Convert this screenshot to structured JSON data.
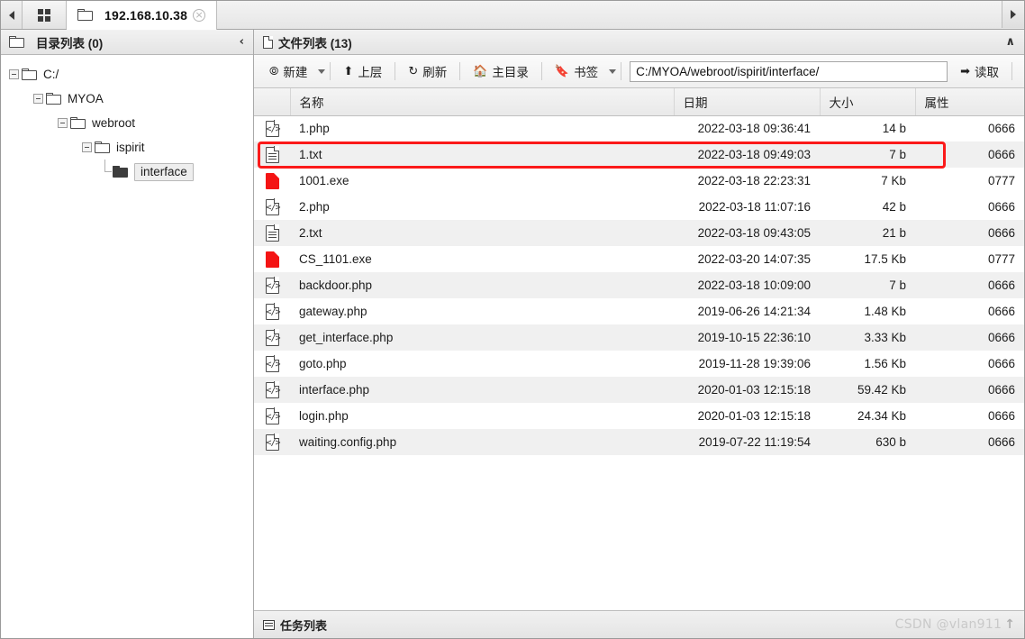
{
  "window": {
    "tab_scroll_left_icon": "triangle-left-icon",
    "tab_scroll_right_icon": "triangle-right-icon",
    "home_tab_icon": "grid-apps-icon",
    "collapse_icon": "chevron-up-icon"
  },
  "tabs": [
    {
      "label": "192.168.10.38",
      "icon": "folder-icon",
      "active": true,
      "closable": true,
      "close_label": "×"
    }
  ],
  "tree_panel": {
    "title": "目录列表 (0)",
    "title_icon": "folder-icon",
    "collapse_icon": "chevron-left-icon",
    "collapse_label": "‹",
    "nodes": [
      {
        "label": "C:/",
        "depth": 0,
        "expanded": true,
        "selected": false,
        "icon": "folder-open-icon"
      },
      {
        "label": "MYOA",
        "depth": 1,
        "expanded": true,
        "selected": false,
        "icon": "folder-open-icon"
      },
      {
        "label": "webroot",
        "depth": 2,
        "expanded": true,
        "selected": false,
        "icon": "folder-open-icon"
      },
      {
        "label": "ispirit",
        "depth": 3,
        "expanded": true,
        "selected": false,
        "icon": "folder-open-icon"
      },
      {
        "label": "interface",
        "depth": 4,
        "expanded": false,
        "selected": true,
        "icon": "folder-filled-icon"
      }
    ]
  },
  "file_panel": {
    "title": "文件列表 (13)",
    "title_icon": "document-icon",
    "collapse_label": "∧",
    "toolbar": {
      "new_label": "新建",
      "new_icon": "plus-circle-icon",
      "new_has_dropdown": true,
      "up_label": "上层",
      "up_icon": "arrow-up-icon",
      "refresh_label": "刷新",
      "refresh_icon": "refresh-icon",
      "home_label": "主目录",
      "home_icon": "home-icon",
      "bookmark_label": "书签",
      "bookmark_icon": "bookmark-icon",
      "bookmark_has_dropdown": true,
      "path_value": "C:/MYOA/webroot/ispirit/interface/",
      "path_placeholder": "",
      "read_label": "读取",
      "read_icon": "arrow-right-icon"
    },
    "columns": [
      "",
      "名称",
      "日期",
      "大小",
      "属性"
    ],
    "rows": [
      {
        "icon": "php-file-icon",
        "name": "1.php",
        "date": "2022-03-18 09:36:41",
        "size": "14 b",
        "attr": "0666",
        "danger": false
      },
      {
        "icon": "txt-file-icon",
        "name": "1.txt",
        "date": "2022-03-18 09:49:03",
        "size": "7 b",
        "attr": "0666",
        "danger": false
      },
      {
        "icon": "exe-file-icon",
        "name": "1001.exe",
        "date": "2022-03-18 22:23:31",
        "size": "7 Kb",
        "attr": "0777",
        "danger": true
      },
      {
        "icon": "php-file-icon",
        "name": "2.php",
        "date": "2022-03-18 11:07:16",
        "size": "42 b",
        "attr": "0666",
        "danger": false
      },
      {
        "icon": "txt-file-icon",
        "name": "2.txt",
        "date": "2022-03-18 09:43:05",
        "size": "21 b",
        "attr": "0666",
        "danger": false
      },
      {
        "icon": "exe-file-icon",
        "name": "CS_1101.exe",
        "date": "2022-03-20 14:07:35",
        "size": "17.5 Kb",
        "attr": "0777",
        "danger": true
      },
      {
        "icon": "php-file-icon",
        "name": "backdoor.php",
        "date": "2022-03-18 10:09:00",
        "size": "7 b",
        "attr": "0666",
        "danger": false
      },
      {
        "icon": "php-file-icon",
        "name": "gateway.php",
        "date": "2019-06-26 14:21:34",
        "size": "1.48 Kb",
        "attr": "0666",
        "danger": false
      },
      {
        "icon": "php-file-icon",
        "name": "get_interface.php",
        "date": "2019-10-15 22:36:10",
        "size": "3.33 Kb",
        "attr": "0666",
        "danger": false
      },
      {
        "icon": "php-file-icon",
        "name": "goto.php",
        "date": "2019-11-28 19:39:06",
        "size": "1.56 Kb",
        "attr": "0666",
        "danger": false
      },
      {
        "icon": "php-file-icon",
        "name": "interface.php",
        "date": "2020-01-03 12:15:18",
        "size": "59.42 Kb",
        "attr": "0666",
        "danger": false
      },
      {
        "icon": "php-file-icon",
        "name": "login.php",
        "date": "2020-01-03 12:15:18",
        "size": "24.34 Kb",
        "attr": "0666",
        "danger": false
      },
      {
        "icon": "php-file-icon",
        "name": "waiting.config.php",
        "date": "2019-07-22 11:19:54",
        "size": "630 b",
        "attr": "0666",
        "danger": false
      }
    ],
    "highlight_row_index": 2
  },
  "statusbar": {
    "tasks_label": "任务列表",
    "tasks_icon": "list-icon",
    "watermark": "CSDN @vlan911",
    "scroll_top_icon": "arrow-up-icon",
    "scroll_top_label": "↑"
  },
  "colors": {
    "danger": "#f02020",
    "highlight_box": "#fb1a1a",
    "row_alt": "#f0f0f0"
  }
}
